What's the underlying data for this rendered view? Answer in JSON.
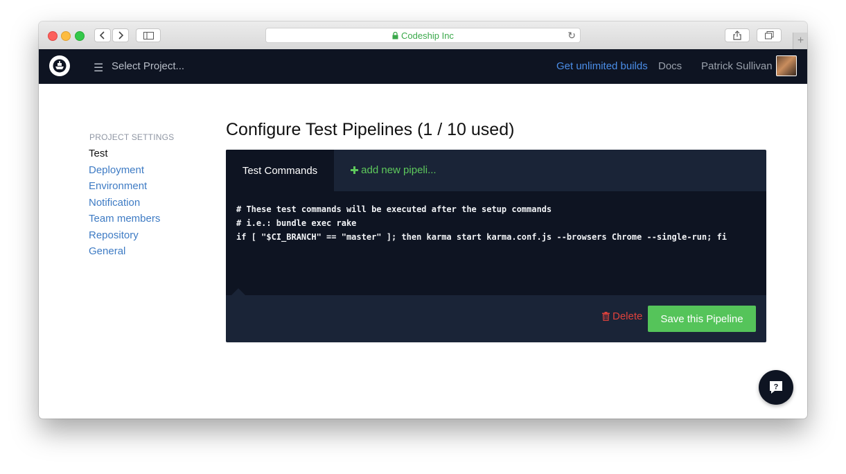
{
  "browser": {
    "url_text": "Codeship Inc",
    "new_tab_symbol": "+"
  },
  "nav": {
    "select_project": "Select Project...",
    "get_unlimited": "Get unlimited builds",
    "docs": "Docs",
    "user_name": "Patrick Sullivan"
  },
  "sidebar": {
    "heading": "PROJECT SETTINGS",
    "items": [
      {
        "label": "Test"
      },
      {
        "label": "Deployment"
      },
      {
        "label": "Environment"
      },
      {
        "label": "Notification"
      },
      {
        "label": "Team members"
      },
      {
        "label": "Repository"
      },
      {
        "label": "General"
      }
    ]
  },
  "main": {
    "title": "Configure Test Pipelines (1 / 10 used)",
    "tabs": {
      "active": "Test Commands",
      "add": "add new pipeli..."
    },
    "code_lines": [
      "# These test commands will be executed after the setup commands",
      "# i.e.: bundle exec rake",
      "if [ \"$CI_BRANCH\" == \"master\" ]; then karma start karma.conf.js --browsers Chrome --single-run; fi"
    ],
    "delete_label": "Delete",
    "save_label": "Save this Pipeline"
  },
  "colors": {
    "nav_bg": "#0e1422",
    "panel_bg": "#1a2437",
    "link": "#3e7bc4",
    "accent_green": "#55c45a",
    "danger": "#e0423c"
  }
}
